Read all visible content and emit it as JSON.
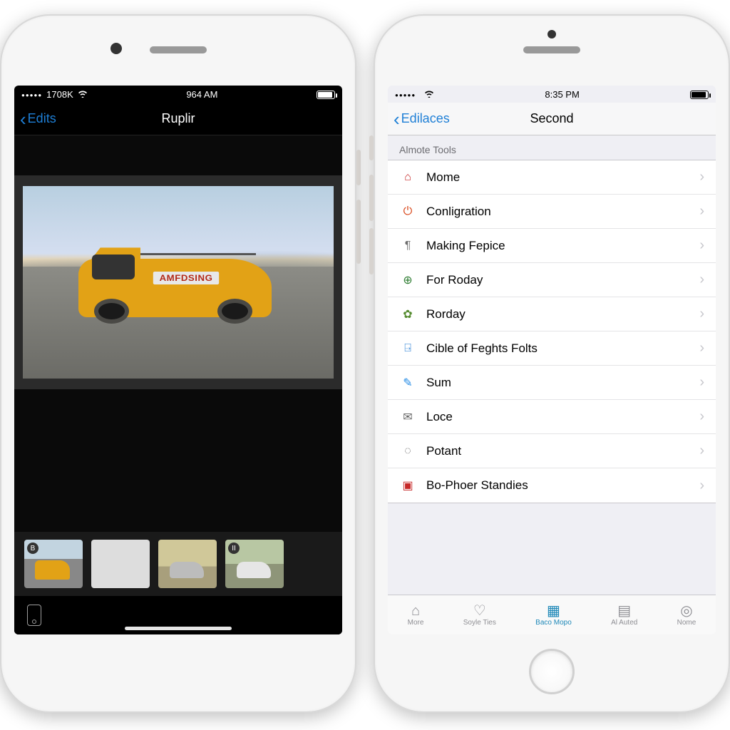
{
  "left": {
    "status": {
      "carrier": "1708K",
      "time": "964 AM"
    },
    "back_label": "Edits",
    "title": "Ruplir",
    "main_photo_logo": "AMFDSING",
    "thumbnails": [
      {
        "badge": "B",
        "kind": "van"
      },
      {
        "badge": "",
        "kind": "mech"
      },
      {
        "badge": "",
        "kind": "car1"
      },
      {
        "badge": "II",
        "kind": "car2"
      }
    ]
  },
  "right": {
    "status": {
      "carrier": "",
      "time": "8:35 PM"
    },
    "back_label": "Edilaces",
    "title": "Second",
    "section_header": "Almote Tools",
    "list": [
      {
        "icon_name": "mome-icon",
        "icon_color": "#c62828",
        "glyph": "⌂",
        "label": "Mome"
      },
      {
        "icon_name": "power-icon",
        "icon_color": "#d84315",
        "glyph": "⏻",
        "label": "Conligration"
      },
      {
        "icon_name": "making-icon",
        "icon_color": "#6d6d6d",
        "glyph": "¶",
        "label": "Making Fepice"
      },
      {
        "icon_name": "roday-icon",
        "icon_color": "#2e7d32",
        "glyph": "⊕",
        "label": "For Roday"
      },
      {
        "icon_name": "plant-icon",
        "icon_color": "#558b2f",
        "glyph": "✿",
        "label": "Rorday"
      },
      {
        "icon_name": "bag-icon",
        "icon_color": "#1976d2",
        "glyph": "⍈",
        "label": "Cible of Feghts Folts"
      },
      {
        "icon_name": "wand-icon",
        "icon_color": "#1e88e5",
        "glyph": "✎",
        "label": "Sum"
      },
      {
        "icon_name": "mail-icon",
        "icon_color": "#616161",
        "glyph": "✉",
        "label": "Loce"
      },
      {
        "icon_name": "chat-icon",
        "icon_color": "#616161",
        "glyph": "◌",
        "label": "Potant"
      },
      {
        "icon_name": "standies-icon",
        "icon_color": "#c62828",
        "glyph": "▣",
        "label": "Bo-Phoer Standies"
      }
    ],
    "tabs": [
      {
        "name": "tab-more",
        "glyph": "⌂",
        "label": "More",
        "active": false
      },
      {
        "name": "tab-soyle",
        "glyph": "♡",
        "label": "Soyle Ties",
        "active": false
      },
      {
        "name": "tab-baco",
        "glyph": "▦",
        "label": "Baco Mopo",
        "active": true
      },
      {
        "name": "tab-alauted",
        "glyph": "▤",
        "label": "Al Auted",
        "active": false
      },
      {
        "name": "tab-nome",
        "glyph": "◎",
        "label": "Nome",
        "active": false
      }
    ]
  }
}
